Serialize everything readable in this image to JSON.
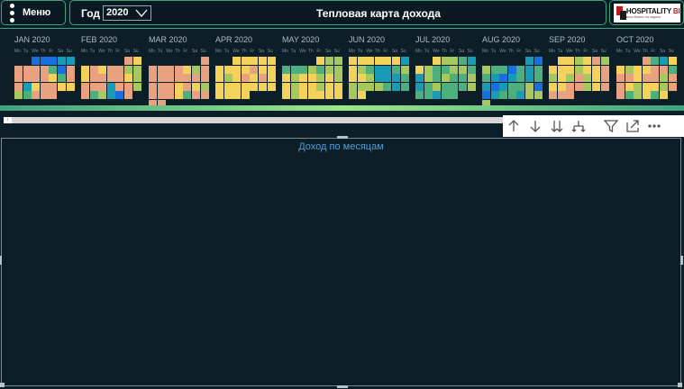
{
  "header": {
    "menu_label": "Меню",
    "year_label": "Год",
    "year_value": "2020",
    "title": "Тепловая карта дохода",
    "logo_main": "HOSPITALITY",
    "logo_bi": "BI",
    "logo_sub": "весь бизнес на ладони"
  },
  "weekdays": [
    "Mo",
    "Tu",
    "We",
    "Th",
    "Fr",
    "Sa",
    "Su"
  ],
  "colors": {
    "level_1": "#e9a27f",
    "level_2": "#f3d15a",
    "level_3": "#a7c85e",
    "level_4": "#4caf7d",
    "level_5": "#1a9bb5",
    "level_6": "#1a6fe0",
    "background": "#0c1e27",
    "accent": "#3fa27f",
    "chart_title": "#4f9fd8"
  },
  "months": [
    {
      "label": "JAN 2020",
      "start": 2,
      "levels": [
        6,
        6,
        6,
        5,
        5,
        1,
        1,
        1,
        1,
        4,
        6,
        1,
        1,
        1,
        1,
        1,
        2,
        4,
        1,
        1,
        5,
        2,
        1,
        1,
        2,
        2,
        3,
        4,
        1,
        1,
        1
      ]
    },
    {
      "label": "FEB 2020",
      "start": 5,
      "levels": [
        1,
        2,
        2,
        1,
        2,
        1,
        1,
        3,
        3,
        2,
        1,
        1,
        1,
        1,
        2,
        3,
        1,
        1,
        1,
        5,
        1,
        1,
        3,
        1,
        4,
        3,
        5,
        6,
        1
      ]
    },
    {
      "label": "MAR 2020",
      "start": 6,
      "levels": [
        1,
        1,
        1,
        1,
        1,
        2,
        3,
        1,
        1,
        1,
        1,
        1,
        1,
        1,
        1,
        1,
        1,
        1,
        2,
        1,
        2,
        3,
        1,
        1,
        1,
        2,
        4,
        1,
        1,
        1,
        1
      ]
    },
    {
      "label": "APR 2020",
      "start": 2,
      "levels": [
        2,
        2,
        2,
        2,
        2,
        2,
        2,
        2,
        2,
        1,
        2,
        2,
        2,
        3,
        2,
        1,
        2,
        1,
        2,
        2,
        2,
        2,
        2,
        2,
        2,
        2,
        2,
        2,
        2,
        2
      ]
    },
    {
      "label": "MAY 2020",
      "start": 4,
      "levels": [
        2,
        3,
        3,
        4,
        4,
        4,
        3,
        4,
        3,
        3,
        2,
        3,
        2,
        2,
        3,
        2,
        3,
        2,
        3,
        2,
        2,
        3,
        2,
        2,
        2,
        3,
        2,
        2,
        2,
        2,
        2
      ]
    },
    {
      "label": "JUN 2020",
      "start": 0,
      "levels": [
        2,
        2,
        2,
        2,
        2,
        2,
        5,
        2,
        3,
        4,
        5,
        5,
        4,
        3,
        2,
        2,
        3,
        5,
        5,
        5,
        4,
        3,
        3,
        3,
        3,
        4,
        5,
        4,
        3,
        2
      ]
    },
    {
      "label": "JUL 2020",
      "start": 2,
      "levels": [
        2,
        3,
        3,
        4,
        5,
        2,
        3,
        4,
        4,
        3,
        3,
        4,
        5,
        3,
        4,
        3,
        4,
        4,
        3,
        5,
        4,
        3,
        4,
        4,
        4,
        3,
        4,
        4,
        5,
        4,
        4
      ]
    },
    {
      "label": "AUG 2020",
      "start": 5,
      "levels": [
        5,
        6,
        3,
        4,
        4,
        6,
        4,
        5,
        4,
        4,
        5,
        6,
        5,
        4,
        5,
        4,
        5,
        6,
        5,
        4,
        4,
        3,
        6,
        6,
        5,
        4,
        4,
        5,
        3,
        3,
        3
      ]
    },
    {
      "label": "SEP 2020",
      "start": 1,
      "levels": [
        2,
        2,
        3,
        2,
        1,
        3,
        2,
        2,
        2,
        3,
        2,
        2,
        1,
        3,
        2,
        3,
        1,
        3,
        2,
        1,
        2,
        2,
        1,
        1,
        3,
        2,
        1,
        1,
        1,
        1
      ]
    },
    {
      "label": "OCT 2020",
      "start": 3,
      "levels": [
        1,
        4,
        5,
        2,
        2,
        3,
        2,
        2,
        1,
        1,
        4,
        1,
        1,
        2,
        1,
        1,
        3,
        1,
        1,
        2,
        3,
        2,
        2,
        3,
        1,
        1,
        4,
        3,
        2,
        4,
        2
      ]
    }
  ],
  "chart": {
    "title": "Доход по месяцам"
  }
}
